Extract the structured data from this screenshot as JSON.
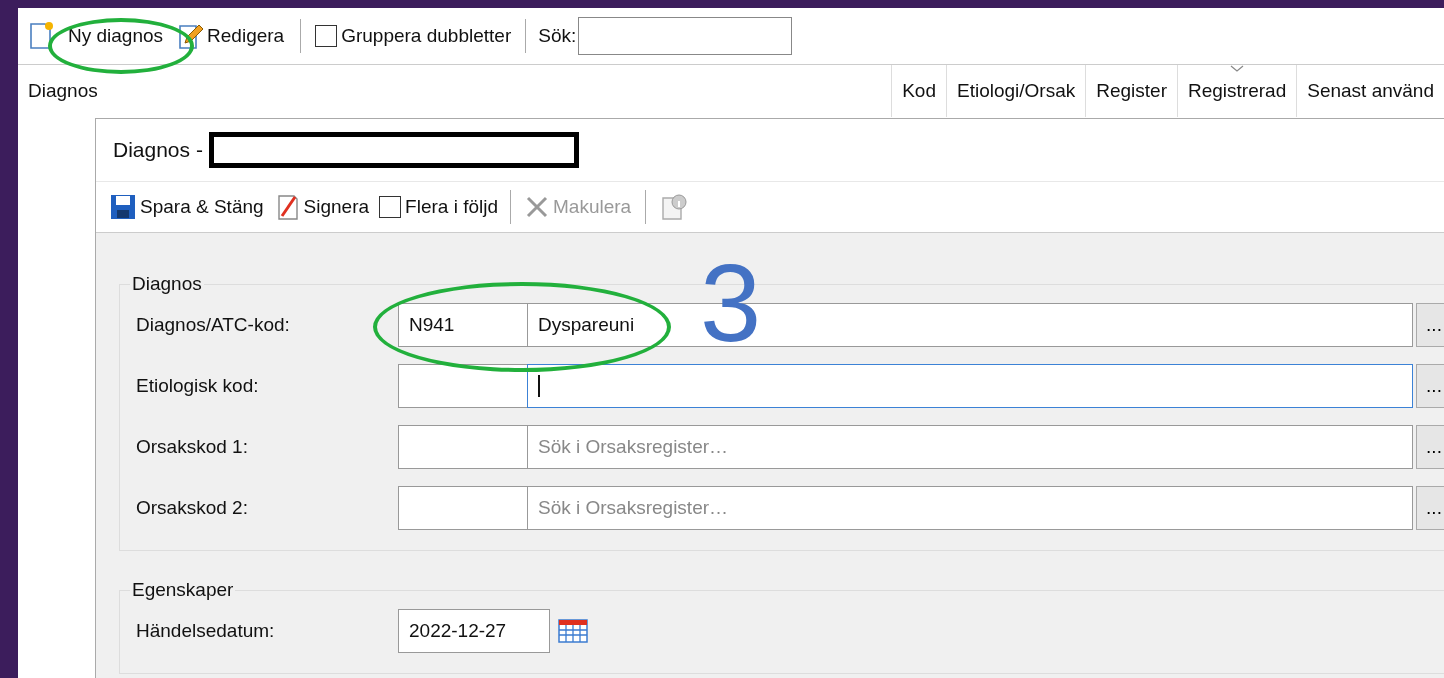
{
  "toolbar": [
    {
      "kind": "button",
      "label": "Ny diagnos"
    },
    {
      "kind": "button",
      "label": "Redigera"
    },
    {
      "kind": "separator"
    },
    {
      "kind": "checkbox",
      "label": "Gruppera dubbletter",
      "checked": false
    },
    {
      "kind": "separator"
    },
    {
      "kind": "search",
      "label": "Sök:"
    }
  ],
  "table": {
    "columns": [
      {
        "label": "Diagnos",
        "sorted": false
      },
      {
        "label": "Kod",
        "sorted": false
      },
      {
        "label": "Etiologi/Orsak",
        "sorted": false
      },
      {
        "label": "Register",
        "sorted": false
      },
      {
        "label": "Registrerad",
        "sorted": true
      },
      {
        "label": "Senast använd",
        "sorted": false
      }
    ]
  },
  "dialog": {
    "title": "Diagnos -",
    "toolbar": [
      {
        "kind": "button",
        "label": "Spara & Stäng",
        "disabled": false
      },
      {
        "kind": "button",
        "label": "Signera",
        "disabled": false
      },
      {
        "kind": "checkbox",
        "label": "Flera i följd",
        "checked": false
      },
      {
        "kind": "separator"
      },
      {
        "kind": "button",
        "label": "Makulera",
        "disabled": true
      },
      {
        "kind": "separator"
      },
      {
        "kind": "icon-button"
      }
    ],
    "groups": [
      {
        "legend": "Diagnos",
        "rows": [
          {
            "kind": "code",
            "label": "Diagnos/ATC-kod:",
            "code": "N941",
            "value": "Dyspareuni",
            "focused": false,
            "button": "..."
          },
          {
            "kind": "code",
            "label": "Etiologisk kod:",
            "focused": true,
            "button": "..."
          },
          {
            "kind": "code",
            "label": "Orsakskod 1:",
            "placeholder": "Sök i Orsaksregister…",
            "focused": false,
            "button": "..."
          },
          {
            "kind": "code",
            "label": "Orsakskod 2:",
            "placeholder": "Sök i Orsaksregister…",
            "focused": false,
            "button": "..."
          }
        ]
      },
      {
        "legend": "Egenskaper",
        "rows": [
          {
            "kind": "date",
            "label": "Händelsedatum:",
            "value": "2022-12-27"
          }
        ]
      }
    ]
  },
  "annotation": {
    "label": "3"
  }
}
